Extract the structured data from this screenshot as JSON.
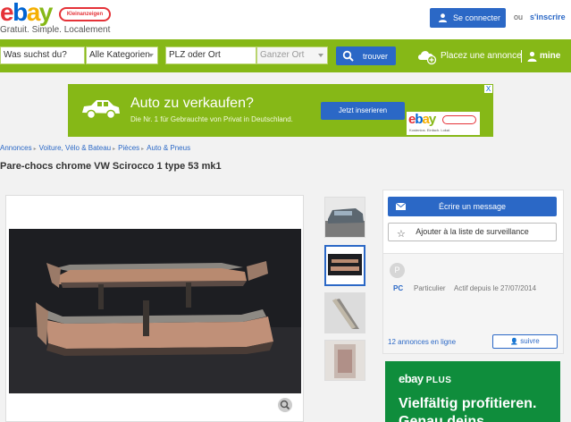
{
  "header": {
    "logo": {
      "e": "e",
      "b": "b",
      "a": "a",
      "y": "y"
    },
    "logo_badge": "Kleinanzeigen",
    "tagline": "Gratuit. Simple. Localement",
    "connect_label": "Se connecter",
    "or_text": "ou",
    "signup_label": "s'inscrire"
  },
  "search": {
    "query_placeholder": "Was suchst du?",
    "category_value": "Alle Kategorien",
    "location_placeholder": "PLZ oder Ort",
    "radius_value": "Ganzer Ort",
    "submit_label": "trouver",
    "place_ad_label": "Placez une annonce",
    "my_label": "mine"
  },
  "ad_banner": {
    "title": "Auto zu verkaufen?",
    "subtitle": "Die Nr. 1 für Gebrauchte von Privat in Deutschland.",
    "button_label": "Jetzt inserieren",
    "logo_text": "ebay",
    "logo_sub": "Kostenlos. Einfach. Lokal.",
    "close_label": "X"
  },
  "breadcrumb": [
    "Annonces",
    "Voiture, Vélo & Bateau",
    "Pièces",
    "Auto & Pneus"
  ],
  "page_title": "Pare-chocs chrome VW Scirocco 1 type 53 mk1",
  "contact": {
    "message_label": "Écrire un message",
    "watch_label": "Ajouter à la liste de surveillance",
    "avatar_letter": "P",
    "seller_name": "PC",
    "seller_type": "Particulier",
    "active_since": "Actif depuis le 27/07/2014",
    "listing_count": "12 annonces en ligne",
    "follow_label": "suivre"
  },
  "promo": {
    "logo": "ebay",
    "logo_plus": "PLUS",
    "headline_1": "Vielfältig profitieren.",
    "headline_2": "Genau deins."
  },
  "colors": {
    "brand_green": "#86b817",
    "brand_blue": "#2b68c6",
    "plus_green": "#0f8d3c"
  }
}
